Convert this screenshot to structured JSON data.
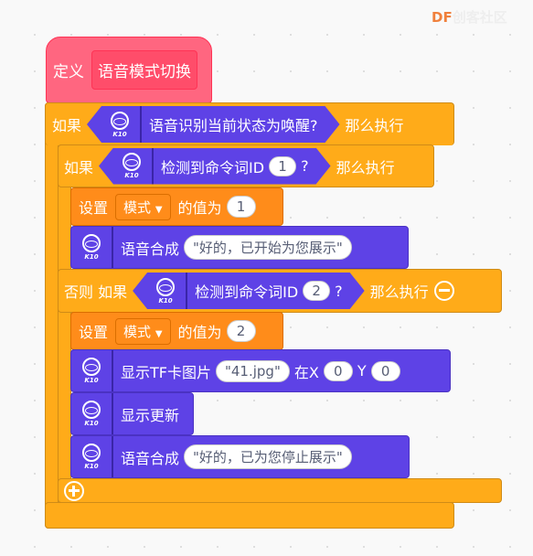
{
  "watermark": {
    "brand": "DF",
    "name": "创客社区"
  },
  "icon_label": "K10",
  "define": {
    "keyword": "定义",
    "name": "语音模式切换"
  },
  "outer_if": {
    "keyword": "如果",
    "condition": "语音识别当前状态为唤醒?",
    "then": "那么执行"
  },
  "inner_if": {
    "keyword": "如果",
    "condition": "检测到命令词ID",
    "id": "1",
    "q": "?",
    "then": "那么执行"
  },
  "set1": {
    "keyword": "设置",
    "variable": "模式",
    "to": "的值为",
    "value": "1"
  },
  "speak1": {
    "label": "语音合成",
    "text": "\"好的，已开始为您展示\""
  },
  "else_if": {
    "keyword": "否则 如果",
    "condition": "检测到命令词ID",
    "id": "2",
    "q": "?",
    "then": "那么执行"
  },
  "set2": {
    "keyword": "设置",
    "variable": "模式",
    "to": "的值为",
    "value": "2"
  },
  "show_image": {
    "label": "显示TF卡图片",
    "file": "\"41.jpg\"",
    "at_x": "在X",
    "x": "0",
    "y_label": "Y",
    "y": "0"
  },
  "refresh": {
    "label": "显示更新"
  },
  "speak2": {
    "label": "语音合成",
    "text": "\"好的，已为您停止展示\""
  },
  "colors": {
    "control": "#ffab19",
    "variable": "#ff8c1a",
    "k10": "#5e42e6",
    "define": "#ff6680"
  }
}
